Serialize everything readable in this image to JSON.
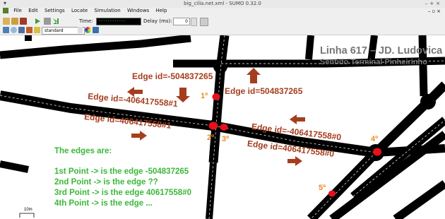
{
  "window": {
    "title": "big_cilia.net.xml - SUMO 0.32.0"
  },
  "menu": [
    "File",
    "Edit",
    "Settings",
    "Locate",
    "Simulation",
    "Windows",
    "Help"
  ],
  "toolbar": {
    "time_label": "Time:",
    "time_value": "------------",
    "delay_label": "Delay (ms):",
    "delay_value": "0"
  },
  "toolbar2": {
    "scheme": "standard"
  },
  "map": {
    "heading": "Linha 617 – JD. Ludovica",
    "subheading": "Sentido Terminal Pinheirinho",
    "edge_labels": [
      "Edge id=-504837265",
      "Edge id=504837265",
      "Edge id=-406417558#1",
      "Edge id=406417558#1",
      "Edge id=-406417558#0",
      "Edge id=406417558#0"
    ],
    "points": [
      "1º",
      "2º",
      "3º",
      "4º",
      "5º"
    ],
    "notes_title": "The edges are:",
    "notes": [
      "1st Point -> is the edge -504837265",
      "2nd Point -> is the edge ??",
      "3rd Point -> is the edge 40617558#0",
      "4th Point -> is the edge ..."
    ],
    "scale_label": "10m"
  },
  "colors": {
    "arrow": "#a53e1e",
    "point": "#e8101a",
    "text_green": "#3ab83a",
    "order": "#e98c22"
  }
}
